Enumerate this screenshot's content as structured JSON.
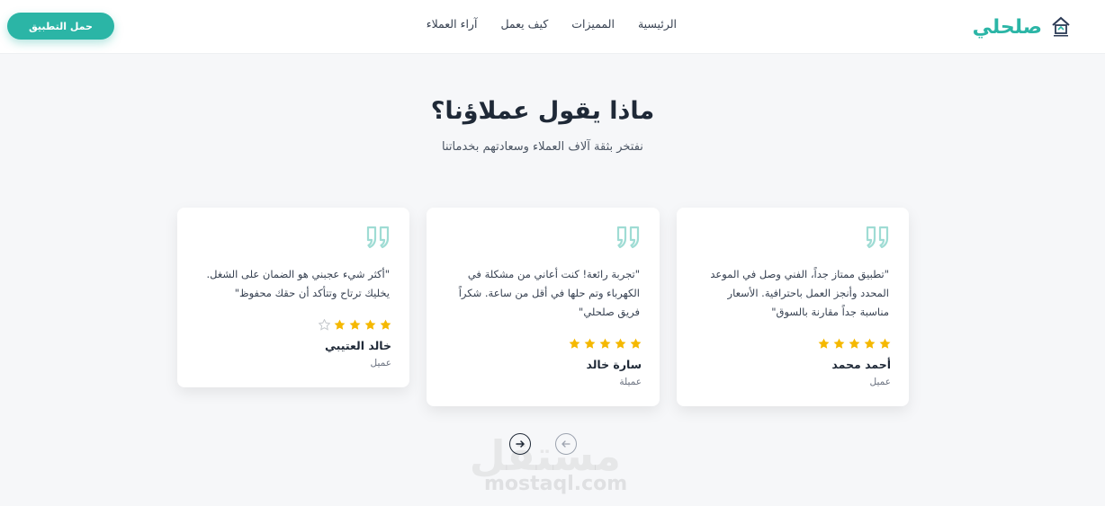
{
  "header": {
    "logo_text": "صلحلي",
    "logo_icon": "house-logo-icon",
    "nav": [
      {
        "label": "الرئيسية"
      },
      {
        "label": "المميزات"
      },
      {
        "label": "كيف يعمل"
      },
      {
        "label": "آراء العملاء"
      }
    ],
    "cta_label": "حمل التطبيق"
  },
  "section": {
    "title": "ماذا يقول عملاؤنا؟",
    "subtitle": "نفتخر بثقة آلاف العملاء وسعادتهم بخدماتنا"
  },
  "testimonials": [
    {
      "lines": [
        "\"تطبيق ممتاز جداً، الفني وصل في الموعد",
        "المحدد وأنجز العمل باحترافية. الأسعار",
        "مناسبة جداً مقارنة بالسوق\""
      ],
      "rating": 5,
      "name": "أحمد محمد",
      "role": "عميل"
    },
    {
      "lines": [
        "\"تجربة رائعة! كنت أعاني من مشكلة في",
        "الكهرباء وتم حلها في أقل من ساعة. شكراً",
        "فريق صلحلي\""
      ],
      "rating": 5,
      "name": "سارة خالد",
      "role": "عميلة"
    },
    {
      "lines": [
        "\"أكثر شيء عجبني هو الضمان على الشغل.",
        "يخليك ترتاح وتتأكد أن حقك محفوظ\""
      ],
      "rating": 4,
      "name": "خالد العتيبي",
      "role": "عميل"
    }
  ],
  "pager": {
    "next_icon": "arrow-right-icon",
    "prev_icon": "arrow-left-icon"
  },
  "watermark": {
    "arabic": "مستقل",
    "latin": "mostaql.com"
  },
  "colors": {
    "accent": "#2bb5a6",
    "star": "#f5b800",
    "star_empty": "#c4c8cc",
    "quote": "#9fdcd4"
  }
}
